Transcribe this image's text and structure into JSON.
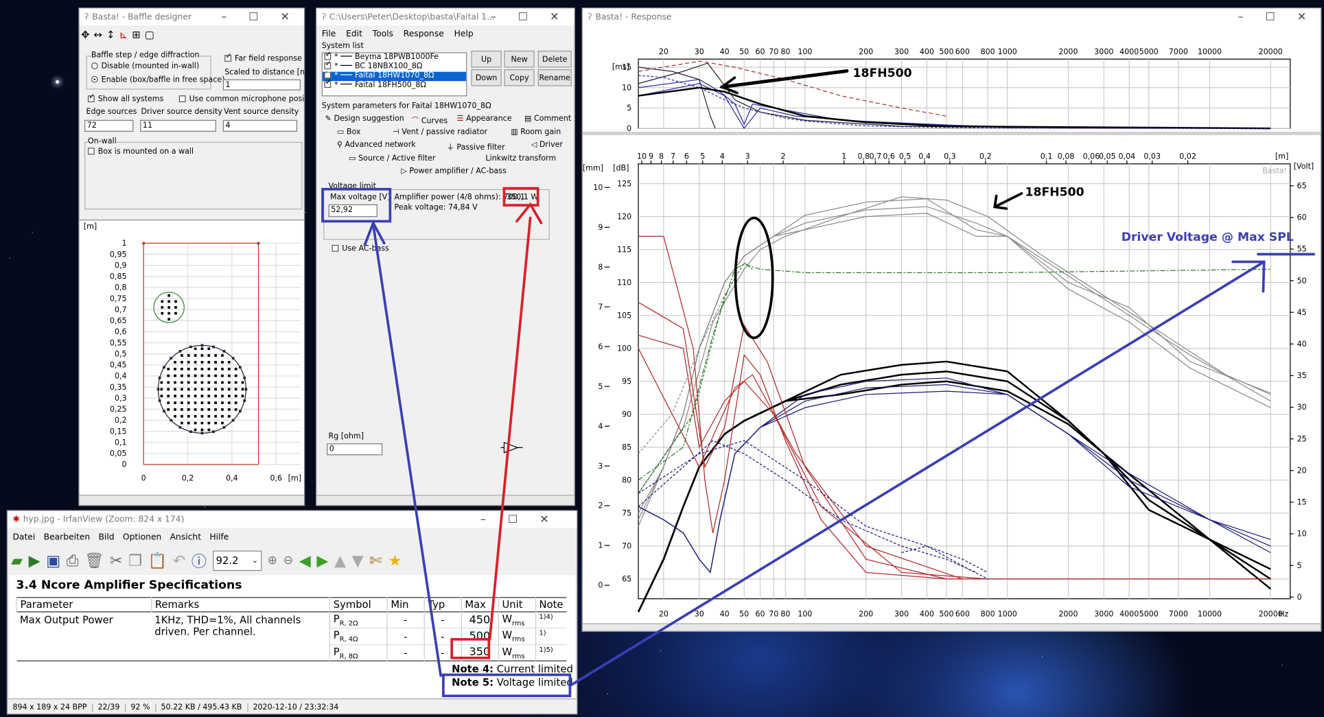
{
  "baffle": {
    "title": "Basta! - Baffle designer",
    "group_label": "Baffle step / edge diffraction",
    "disable_label": "Disable (mounted in-wall)",
    "enable_label": "Enable (box/baffle in free space)",
    "far_label": "Far field response",
    "scaled_label": "Scaled to distance [m]",
    "distance": "1",
    "show_all": "Show all systems",
    "common_mic": "Use common microphone position",
    "edge_label": "Edge sources",
    "driver_label": "Driver source density",
    "vent_label": "Vent source density",
    "edge_val": "72",
    "driver_val": "11",
    "vent_val": "4",
    "onwall_group": "On-wall",
    "onwall_label": "Box is mounted on a wall",
    "plot": {
      "unit": "[m]",
      "yticks": [
        "1",
        "0,95",
        "0,9",
        "0,85",
        "0,8",
        "0,75",
        "0,7",
        "0,65",
        "0,6",
        "0,55",
        "0,5",
        "0,45",
        "0,4",
        "0,35",
        "0,3",
        "0,25",
        "0,2",
        "0,15",
        "0,1",
        "0,05",
        "0"
      ],
      "xticks": [
        "0",
        "0,2",
        "0,4",
        "0,6",
        "[m]"
      ]
    }
  },
  "faital": {
    "title": "C:\\Users\\Peter\\Desktop\\basta\\Faital 1...",
    "menu": [
      "File",
      "Edit",
      "Tools",
      "Response",
      "Help"
    ],
    "syslist_label": "System list",
    "systems": [
      {
        "name": "Beyma 18PWB1000Fe",
        "selected": false
      },
      {
        "name": "BC 18NBX100_8Ω",
        "selected": false
      },
      {
        "name": "Faital 18HW1070_8Ω",
        "selected": true
      },
      {
        "name": "Faital 18FH500_8Ω",
        "selected": false
      }
    ],
    "buttons": {
      "up": "Up",
      "new": "New",
      "delete": "Delete",
      "down": "Down",
      "copy": "Copy",
      "rename": "Rename"
    },
    "params_label": "System parameters for Faital 18HW1070_8Ω",
    "tabs_row1": [
      "Design suggestion",
      "Curves",
      "Appearance",
      "Comment"
    ],
    "tabs_row2": [
      "Box",
      "Vent / passive radiator",
      "Room gain"
    ],
    "tabs_row3": [
      "Advanced network",
      "Passive filter",
      "Driver"
    ],
    "tabs_row4": [
      "Source / Active filter",
      "Linkwitz transform"
    ],
    "tabs_row5": [
      "Power amplifier / AC-bass"
    ],
    "voltage_group": "Voltage limit",
    "max_voltage_label": "Max voltage [V]",
    "max_voltage": "52,92",
    "amp_power": "Amplifier power (4/8 ohms): 700,1",
    "amp_power_8": "350,1 W",
    "peak_voltage": "Peak voltage: 74,84 V",
    "use_acbass": "Use AC-bass",
    "rg_label": "Rg [ohm]",
    "rg_val": "0"
  },
  "irfan": {
    "title": "hyp.jpg - IrfanView (Zoom: 824 x 174)",
    "menu": [
      "Datei",
      "Bearbeiten",
      "Bild",
      "Optionen",
      "Ansicht",
      "Hilfe"
    ],
    "zoom": "92.2",
    "doc_title": "3.4   Ncore Amplifier Specifications",
    "headers": [
      "Parameter",
      "Remarks",
      "Symbol",
      "Min",
      "Typ",
      "Max",
      "Unit",
      "Note"
    ],
    "param": "Max Output Power",
    "remarks": "1KHz, THD=1%, All channels driven. Per channel.",
    "rows": [
      {
        "sym": "P",
        "sub": "R, 2Ω",
        "min": "-",
        "typ": "-",
        "max": "450",
        "unit": "W",
        "usub": "rms",
        "note": "1)4)"
      },
      {
        "sym": "P",
        "sub": "R, 4Ω",
        "min": "-",
        "typ": "-",
        "max": "500",
        "unit": "W",
        "usub": "rms",
        "note": "1)"
      },
      {
        "sym": "P",
        "sub": "R, 8Ω",
        "min": "-",
        "typ": "-",
        "max": "350",
        "unit": "W",
        "usub": "rms",
        "note": "1)5)"
      }
    ],
    "note4_bold": "Note 4:",
    "note4": "Current limited",
    "note5_bold": "Note 5:",
    "note5": "Voltage limited",
    "status": [
      "894 x 189 x 24 BPP",
      "22/39",
      "92 %",
      "50.22 KB / 495.43 KB",
      "2020-12-10 / 23:32:34"
    ]
  },
  "response": {
    "title": "Basta! - Response",
    "top_ylabel": "[ms]",
    "top_yticks": [
      "15",
      "10",
      "5",
      "0"
    ],
    "freq_ticks": [
      "20",
      "30",
      "40",
      "50",
      "60",
      "70",
      "80",
      "100",
      "200",
      "300",
      "400",
      "500",
      "600",
      "800",
      "1000",
      "2000",
      "3000",
      "4000",
      "5000",
      "7000",
      "10000",
      "20000"
    ],
    "freq_unit": "Hz",
    "dist_ticks": [
      "20",
      "10",
      "9",
      "8",
      "7",
      "6",
      "5",
      "4",
      "3",
      "2",
      "1",
      "0,8",
      "0,7",
      "0,6",
      "0,5",
      "0,4",
      "0,3",
      "0,2",
      "0,1",
      "0,08",
      "0,06",
      "0,05",
      "0,04",
      "0,03",
      "0,02"
    ],
    "dist_unit": "[m]",
    "mm_unit": "[mm]",
    "db_unit": "[dB]",
    "volt_unit": "[Volt]",
    "mm_ticks": [
      "10",
      "9",
      "8",
      "7",
      "6",
      "5",
      "4",
      "3",
      "2",
      "1",
      "0"
    ],
    "db_ticks": [
      "125",
      "120",
      "115",
      "110",
      "105",
      "100",
      "95",
      "90",
      "85",
      "80",
      "75",
      "70",
      "65"
    ],
    "volt_ticks": [
      "65",
      "60",
      "55",
      "50",
      "45",
      "40",
      "35",
      "30",
      "25",
      "20",
      "15",
      "10",
      "5",
      "0"
    ],
    "watermark": "Basta!"
  },
  "annotations": {
    "label_top": "18FH500",
    "label_main": "18FH500",
    "driver_voltage": "Driver Voltage @ Max SPL"
  }
}
